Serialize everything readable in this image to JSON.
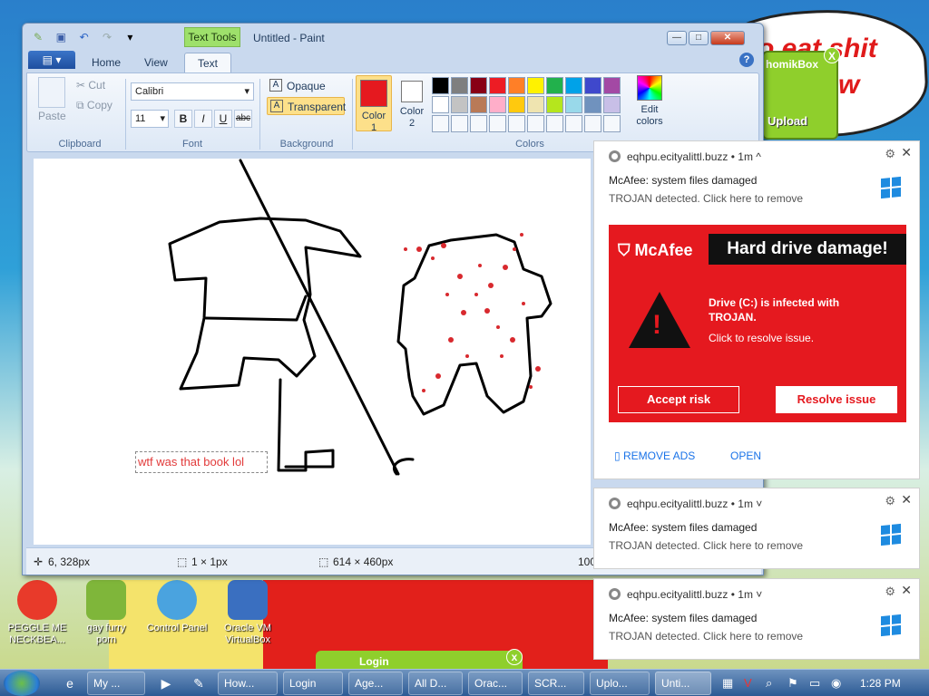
{
  "desktop": {
    "bubble_text": [
      "o eat shit",
      "new"
    ],
    "upload_widget": {
      "title": "homikBox",
      "button": "Upload",
      "close": "X"
    },
    "login_widget": {
      "label": "Login",
      "close": "x"
    },
    "icons": [
      {
        "label": "PEGGLE ME\nNECKBEA...",
        "color": "#e83a2a"
      },
      {
        "label": "gay furry\nporn",
        "color": "#7fb63a"
      },
      {
        "label": "Control Panel",
        "color": "#4aa3df"
      },
      {
        "label": "Oracle VM\nVirtualBox",
        "color": "#3a6fc0"
      }
    ]
  },
  "paint": {
    "context_tab": "Text Tools",
    "title": "Untitled - Paint",
    "window_controls": {
      "minimize": "—",
      "maximize": "□",
      "close": "✕"
    },
    "tabs": [
      "Home",
      "View",
      "Text"
    ],
    "active_tab": "Text",
    "help": "?",
    "clipboard": {
      "paste": "Paste",
      "cut": "Cut",
      "copy": "Copy",
      "group": "Clipboard"
    },
    "font": {
      "family": "Calibri",
      "size": "11",
      "bold": "B",
      "italic": "I",
      "underline": "U",
      "strike": "abc",
      "group": "Font"
    },
    "background": {
      "opaque": "Opaque",
      "transparent": "Transparent",
      "group": "Background"
    },
    "colors": {
      "color1_label": "Color\n1",
      "color2_label": "Color\n2",
      "color1": "#e5191f",
      "color2": "#ffffff",
      "edit_label": "Edit\ncolors",
      "group": "Colors",
      "palette": [
        "#000000",
        "#7f7f7f",
        "#880015",
        "#ed1c24",
        "#ff7f27",
        "#fff200",
        "#22b14c",
        "#00a2e8",
        "#3f48cc",
        "#a349a4",
        "#ffffff",
        "#c3c3c3",
        "#b97a57",
        "#ffaec9",
        "#ffc90e",
        "#efe4b0",
        "#b5e61d",
        "#99d9ea",
        "#7092be",
        "#c8bfe7",
        "#f5f8fc",
        "#f5f8fc",
        "#f5f8fc",
        "#f5f8fc",
        "#f5f8fc",
        "#f5f8fc",
        "#f5f8fc",
        "#f5f8fc",
        "#f5f8fc",
        "#f5f8fc"
      ]
    },
    "canvas_text": "wtf was that book lol",
    "status": {
      "cursor": "6, 328px",
      "selection": "1 × 1px",
      "size": "614 × 460px",
      "zoom": "100"
    }
  },
  "notifications": [
    {
      "site": "eqhpu.ecityalittl.buzz",
      "age": "• 1m ^",
      "title": "McAfee: system files damaged",
      "body": "TROJAN detected. Click here to remove"
    },
    {
      "site": "eqhpu.ecityalittl.buzz",
      "age": "• 1m ˅",
      "title": "McAfee: system files damaged",
      "body": "TROJAN detected. Click here to remove"
    },
    {
      "site": "eqhpu.ecityalittl.buzz",
      "age": "• 1m ˅",
      "title": "McAfee: system files damaged",
      "body": "TROJAN detected. Click here to remove"
    }
  ],
  "mcafee": {
    "logo": "McAfee",
    "headline": "Hard drive damage!",
    "line1": "Drive (C:) is infected with TROJAN.",
    "line2": "Click to resolve issue.",
    "accept": "Accept risk",
    "resolve": "Resolve issue",
    "remove_ads": "▯ REMOVE ADS",
    "open": "OPEN"
  },
  "taskbar": {
    "items": [
      "My ...",
      "How...",
      "Login",
      "Age...",
      "All D...",
      "Orac...",
      "SCR...",
      "Uplo...",
      "Unti..."
    ],
    "clock": "1:28 PM"
  }
}
